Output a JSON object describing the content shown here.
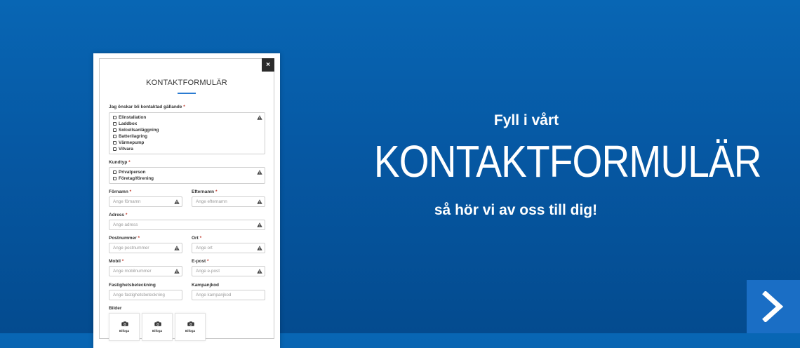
{
  "modal": {
    "close_label": "×",
    "title": "KONTAKTFORMULÄR",
    "contact_about": {
      "label": "Jag önskar bli kontaktad gällande",
      "required": "*",
      "options": [
        "Elinstallation",
        "Laddbox",
        "Solcellsanläggning",
        "Batterilagring",
        "Värmepump",
        "Vitvara"
      ]
    },
    "customer_type": {
      "label": "Kundtyp",
      "required": "*",
      "options": [
        "Privatperson",
        "Företag/förening"
      ]
    },
    "fields": {
      "first_name": {
        "label": "Förnamn",
        "required": "*",
        "placeholder": "Ange förnamn"
      },
      "last_name": {
        "label": "Efternamn",
        "required": "*",
        "placeholder": "Ange efternamn"
      },
      "address": {
        "label": "Adress",
        "required": "*",
        "placeholder": "Ange adress"
      },
      "postal_code": {
        "label": "Postnummer",
        "required": "*",
        "placeholder": "Ange postnummer"
      },
      "city": {
        "label": "Ort",
        "required": "*",
        "placeholder": "Ange ort"
      },
      "mobile": {
        "label": "Mobil",
        "required": "*",
        "placeholder": "Ange mobilnummer"
      },
      "email": {
        "label": "E-post",
        "required": "*",
        "placeholder": "Ange e-post"
      },
      "property": {
        "label": "Fastighetsbeteckning",
        "placeholder": "Ange fastighetsbeteckning"
      },
      "campaign": {
        "label": "Kampanjkod",
        "placeholder": "Ange kampanjkod"
      }
    },
    "images": {
      "label": "Bilder",
      "upload_label": "Bifoga"
    }
  },
  "hero": {
    "line1": "Fyll i vårt",
    "title": "KONTAKTFORMULÄR",
    "line2": "så hör vi av oss till dig!"
  },
  "icons": {
    "warning": "warning-triangle-icon",
    "camera": "camera-icon",
    "next": "chevron-right-icon"
  },
  "colors": {
    "background": "#0660ad",
    "accent": "#2a7bd1",
    "next_button": "#1a6ec5"
  }
}
